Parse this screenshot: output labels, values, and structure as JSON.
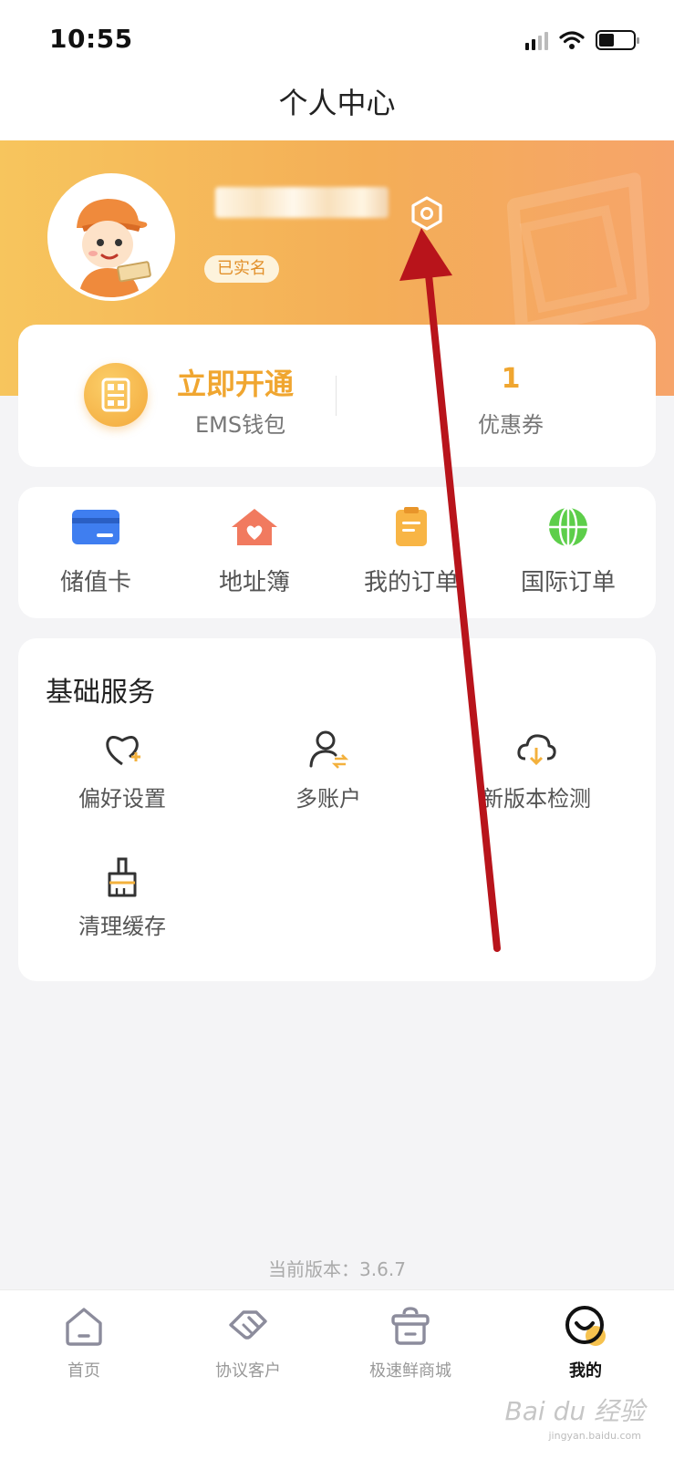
{
  "status_bar": {
    "time": "10:55"
  },
  "nav": {
    "title": "个人中心"
  },
  "profile": {
    "verified_label": "已实名"
  },
  "wallet": {
    "action_label": "立即开通",
    "wallet_label": "EMS钱包",
    "coupon_count": "1",
    "coupon_label": "优惠券"
  },
  "quick_menu": [
    {
      "label": "储值卡",
      "icon": "card-icon"
    },
    {
      "label": "地址簿",
      "icon": "house-icon"
    },
    {
      "label": "我的订单",
      "icon": "clipboard-icon"
    },
    {
      "label": "国际订单",
      "icon": "globe-icon"
    }
  ],
  "services": {
    "title": "基础服务",
    "items": [
      {
        "label": "偏好设置",
        "icon": "heart-plus-icon"
      },
      {
        "label": "多账户",
        "icon": "user-switch-icon"
      },
      {
        "label": "新版本检测",
        "icon": "cloud-download-icon"
      },
      {
        "label": "清理缓存",
        "icon": "brush-icon"
      }
    ]
  },
  "version": {
    "text": "当前版本：3.6.7"
  },
  "tab_bar": [
    {
      "label": "首页",
      "icon": "home-icon",
      "active": false
    },
    {
      "label": "协议客户",
      "icon": "handshake-icon",
      "active": false
    },
    {
      "label": "极速鲜商城",
      "icon": "gift-pot-icon",
      "active": false
    },
    {
      "label": "我的",
      "icon": "smile-icon",
      "active": true
    }
  ],
  "watermark": {
    "brand": "Bai du 经验",
    "url": "jingyan.baidu.com"
  },
  "colors": {
    "accent": "#f0a630",
    "banner_start": "#f7c55d",
    "banner_end": "#f6a46a",
    "annotation_arrow": "#b8141b"
  }
}
